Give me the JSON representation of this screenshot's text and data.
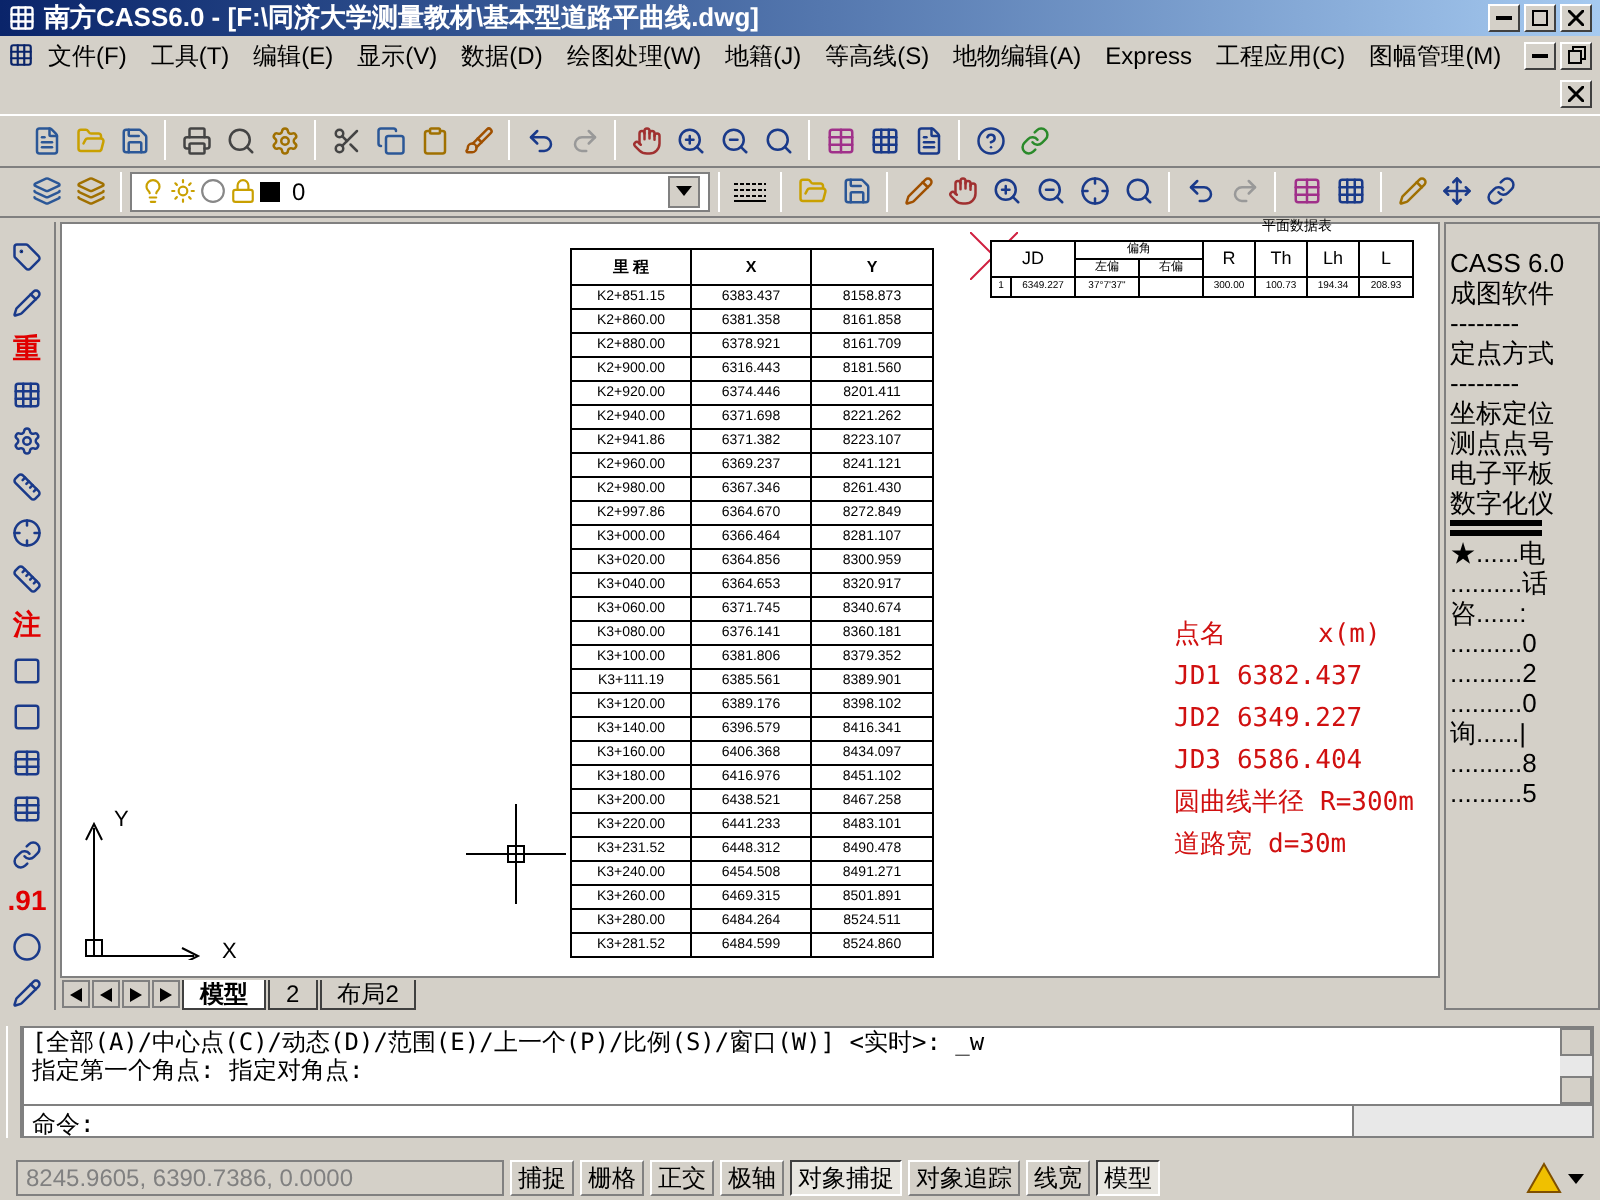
{
  "window": {
    "title": "南方CASS6.0 - [F:\\同济大学测量教材\\基本型道路平曲线.dwg]"
  },
  "menu": [
    "文件(F)",
    "工具(T)",
    "编辑(E)",
    "显示(V)",
    "数据(D)",
    "绘图处理(W)",
    "地籍(J)",
    "等高线(S)",
    "地物编辑(A)",
    "Express",
    "工程应用(C)",
    "图幅管理(M)"
  ],
  "layer": {
    "value": "0"
  },
  "left_toolbar": [
    {
      "kind": "icon"
    },
    {
      "kind": "icon"
    },
    {
      "kind": "text",
      "label": "重"
    },
    {
      "kind": "icon"
    },
    {
      "kind": "icon"
    },
    {
      "kind": "icon"
    },
    {
      "kind": "icon"
    },
    {
      "kind": "icon"
    },
    {
      "kind": "text",
      "label": "注"
    },
    {
      "kind": "icon"
    },
    {
      "kind": "icon"
    },
    {
      "kind": "icon"
    },
    {
      "kind": "icon"
    },
    {
      "kind": "icon"
    },
    {
      "kind": "text",
      "label": ".91"
    },
    {
      "kind": "icon"
    },
    {
      "kind": "icon"
    }
  ],
  "coord_table": {
    "columns": [
      "里 程",
      "X",
      "Y"
    ],
    "rows": [
      [
        "K2+851.15",
        "6383.437",
        "8158.873"
      ],
      [
        "K2+860.00",
        "6381.358",
        "8161.858"
      ],
      [
        "K2+880.00",
        "6378.921",
        "8161.709"
      ],
      [
        "K2+900.00",
        "6316.443",
        "8181.560"
      ],
      [
        "K2+920.00",
        "6374.446",
        "8201.411"
      ],
      [
        "K2+940.00",
        "6371.698",
        "8221.262"
      ],
      [
        "K2+941.86",
        "6371.382",
        "8223.107"
      ],
      [
        "K2+960.00",
        "6369.237",
        "8241.121"
      ],
      [
        "K2+980.00",
        "6367.346",
        "8261.430"
      ],
      [
        "K2+997.86",
        "6364.670",
        "8272.849"
      ],
      [
        "K3+000.00",
        "6366.464",
        "8281.107"
      ],
      [
        "K3+020.00",
        "6364.856",
        "8300.959"
      ],
      [
        "K3+040.00",
        "6364.653",
        "8320.917"
      ],
      [
        "K3+060.00",
        "6371.745",
        "8340.674"
      ],
      [
        "K3+080.00",
        "6376.141",
        "8360.181"
      ],
      [
        "K3+100.00",
        "6381.806",
        "8379.352"
      ],
      [
        "K3+111.19",
        "6385.561",
        "8389.901"
      ],
      [
        "K3+120.00",
        "6389.176",
        "8398.102"
      ],
      [
        "K3+140.00",
        "6396.579",
        "8416.341"
      ],
      [
        "K3+160.00",
        "6406.368",
        "8434.097"
      ],
      [
        "K3+180.00",
        "6416.976",
        "8451.102"
      ],
      [
        "K3+200.00",
        "6438.521",
        "8467.258"
      ],
      [
        "K3+220.00",
        "6441.233",
        "8483.101"
      ],
      [
        "K3+231.52",
        "6448.312",
        "8490.478"
      ],
      [
        "K3+240.00",
        "6454.508",
        "8491.271"
      ],
      [
        "K3+260.00",
        "6469.315",
        "8501.891"
      ],
      [
        "K3+280.00",
        "6484.264",
        "8524.511"
      ],
      [
        "K3+281.52",
        "6484.599",
        "8524.860"
      ]
    ]
  },
  "curve_table": {
    "title": "平面数据表",
    "headers": [
      "JD",
      "偏角",
      "R",
      "Th",
      "Lh",
      "L"
    ],
    "subheaders": [
      "左偏",
      "右偏"
    ],
    "row": {
      "number": "1",
      "jd": "6349.227",
      "left": "37°7'37\"",
      "values": [
        "300.00",
        "100.73",
        "194.34",
        "208.93"
      ]
    }
  },
  "annotations": [
    [
      "点名",
      "x(m)"
    ],
    [
      "JD1",
      "6382.437"
    ],
    [
      "JD2",
      "6349.227"
    ],
    [
      "JD3",
      "6586.404"
    ],
    [
      "圆曲线半径",
      "R=300m"
    ],
    [
      "道路宽",
      "d=30m"
    ]
  ],
  "axis_labels": {
    "y": "Y",
    "x": "X"
  },
  "layout_tabs": [
    {
      "label": "模型",
      "selected": true
    },
    {
      "label": "2",
      "selected": false
    },
    {
      "label": "布局2",
      "selected": false
    }
  ],
  "side_panel": [
    "CASS 6.0",
    "成图软件",
    "--------",
    "定点方式",
    "--------",
    "坐标定位",
    "测点点号",
    "电子平板",
    "数字化仪",
    "★......电",
    "..........话",
    "咨......:",
    "..........0",
    "..........2",
    "..........0",
    "询......|",
    "..........8",
    "..........5"
  ],
  "command": {
    "lines": [
      "[全部(A)/中心点(C)/动态(D)/范围(E)/上一个(P)/比例(S)/窗口(W)] <实时>: _w",
      "指定第一个角点: 指定对角点:"
    ],
    "prompt": "命令:"
  },
  "status": {
    "coords": "8245.9605, 6390.7386, 0.0000",
    "buttons": [
      {
        "label": "捕捉",
        "on": false
      },
      {
        "label": "栅格",
        "on": false
      },
      {
        "label": "正交",
        "on": false
      },
      {
        "label": "极轴",
        "on": false
      },
      {
        "label": "对象捕捉",
        "on": true
      },
      {
        "label": "对象追踪",
        "on": false
      },
      {
        "label": "线宽",
        "on": false
      },
      {
        "label": "模型",
        "on": true
      }
    ]
  }
}
